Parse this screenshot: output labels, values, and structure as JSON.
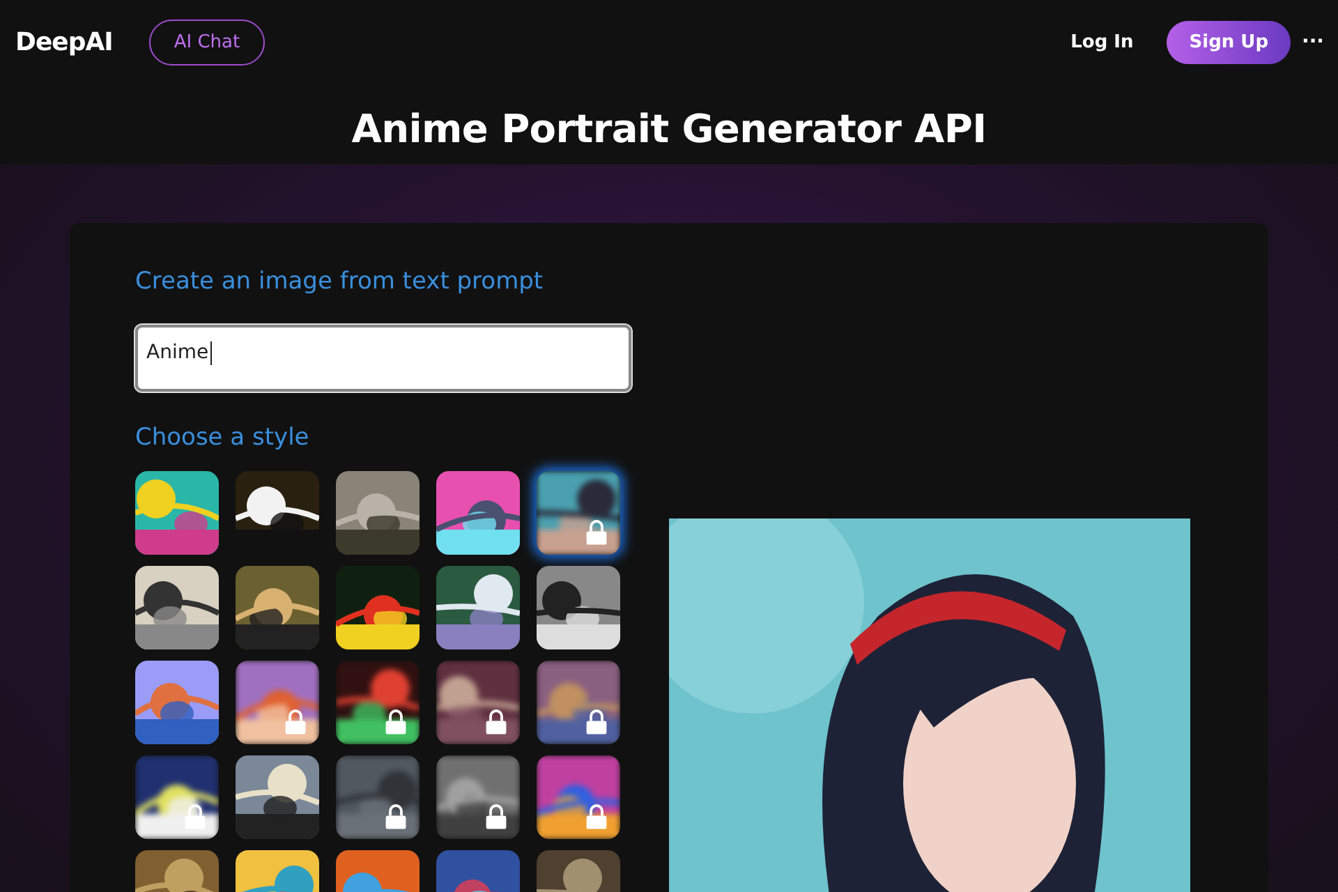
{
  "header": {
    "logo": "DeepAI",
    "chat_button": "AI Chat",
    "login": "Log In",
    "signup": "Sign Up",
    "more": "···"
  },
  "title": "Anime Portrait Generator API",
  "form": {
    "prompt_label": "Create an image from text prompt",
    "prompt_value": "Anime",
    "style_label": "Choose a style"
  },
  "styles": [
    {
      "kind": "picture",
      "locked": false,
      "selected": false
    },
    {
      "kind": "picture",
      "locked": false,
      "selected": false
    },
    {
      "kind": "picture",
      "locked": false,
      "selected": false
    },
    {
      "kind": "picture",
      "locked": false,
      "selected": false
    },
    {
      "kind": "picture",
      "locked": true,
      "selected": true
    },
    {
      "kind": "picture",
      "locked": false,
      "selected": false
    },
    {
      "kind": "picture",
      "locked": false,
      "selected": false
    },
    {
      "kind": "picture",
      "locked": false,
      "selected": false
    },
    {
      "kind": "picture",
      "locked": false,
      "selected": false
    },
    {
      "kind": "picture",
      "locked": false,
      "selected": false
    },
    {
      "kind": "picture",
      "locked": false,
      "selected": false
    },
    {
      "kind": "picture",
      "locked": true,
      "selected": false
    },
    {
      "kind": "picture",
      "locked": true,
      "selected": false
    },
    {
      "kind": "picture",
      "locked": true,
      "selected": false
    },
    {
      "kind": "picture",
      "locked": true,
      "selected": false
    },
    {
      "kind": "picture",
      "locked": true,
      "selected": false
    },
    {
      "kind": "picture",
      "locked": false,
      "selected": false
    },
    {
      "kind": "picture",
      "locked": true,
      "selected": false
    },
    {
      "kind": "picture",
      "locked": true,
      "selected": false
    },
    {
      "kind": "picture",
      "locked": true,
      "selected": false
    },
    {
      "kind": "picture",
      "locked": false,
      "selected": false
    },
    {
      "kind": "picture",
      "locked": false,
      "selected": false
    },
    {
      "kind": "picture",
      "locked": false,
      "selected": false
    },
    {
      "kind": "picture",
      "locked": false,
      "selected": false
    },
    {
      "kind": "picture",
      "locked": false,
      "selected": false
    }
  ],
  "result": {
    "kind": "picture"
  }
}
